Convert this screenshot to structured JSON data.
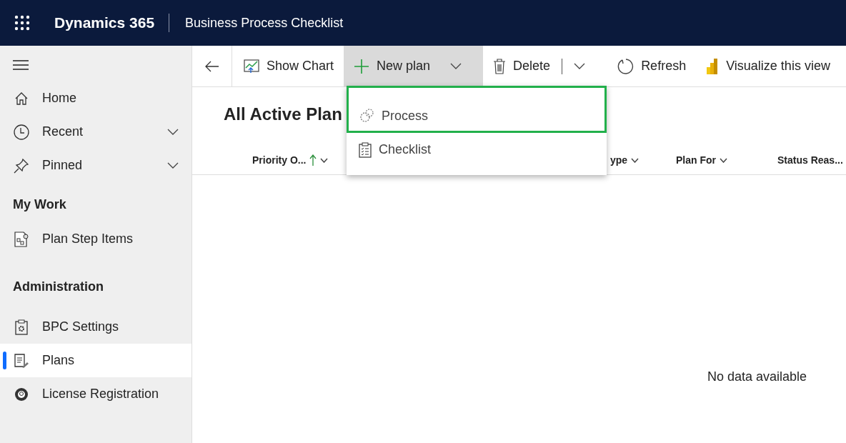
{
  "app_bar": {
    "app_name": "Dynamics 365",
    "page_title": "Business Process Checklist"
  },
  "sidebar": {
    "top_items": [
      {
        "label": "Home",
        "kind": "link"
      },
      {
        "label": "Recent",
        "kind": "flyout",
        "expanded": false
      },
      {
        "label": "Pinned",
        "kind": "flyout",
        "expanded": false
      }
    ],
    "groups": [
      {
        "title": "My Work",
        "items": [
          {
            "label": "Plan Step Items",
            "selected": false
          }
        ]
      },
      {
        "title": "Administration",
        "items": [
          {
            "label": "BPC Settings",
            "selected": false
          },
          {
            "label": "Plans",
            "selected": true
          },
          {
            "label": "License Registration",
            "selected": false
          }
        ]
      }
    ]
  },
  "toolbar": {
    "buttons": [
      {
        "label": "Show Chart",
        "kind": "button"
      },
      {
        "label": "New plan",
        "kind": "split",
        "expanded": true
      },
      {
        "label": "Delete",
        "kind": "split",
        "expanded": false
      },
      {
        "label": "Refresh",
        "kind": "button"
      },
      {
        "label": "Visualize this view",
        "kind": "button"
      }
    ]
  },
  "view": {
    "title": "All Active Plan",
    "columns": [
      {
        "label": "Priority O...",
        "sorted": true
      },
      {
        "label": "ype",
        "sorted": false
      },
      {
        "label": "Plan For",
        "sorted": false
      },
      {
        "label": "Status Reas...",
        "sorted": false
      }
    ],
    "empty_message": "No data available"
  },
  "menu": {
    "items": [
      {
        "label": "Process",
        "highlighted": true
      },
      {
        "label": "Checklist",
        "highlighted": false
      }
    ]
  }
}
